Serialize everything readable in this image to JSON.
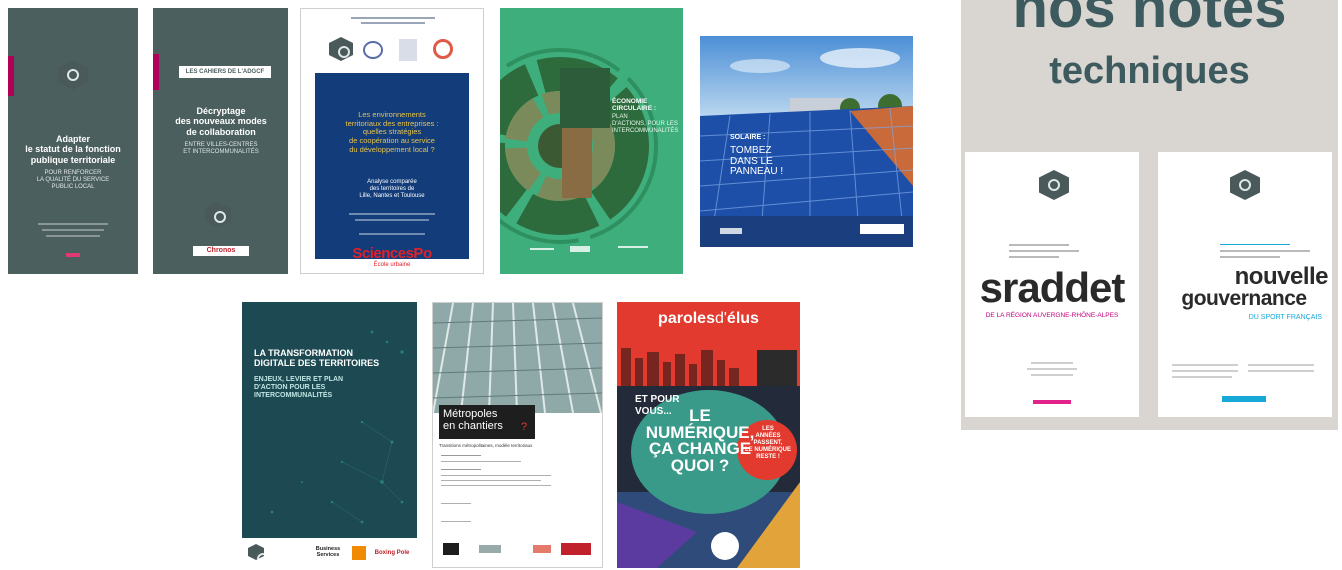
{
  "cover1": {
    "title": "Adapter\nle statut de la fonction\npublique territoriale",
    "subtitle": "POUR RENFORCER\nLA QUALITÉ DU SERVICE\nPUBLIC LOCAL"
  },
  "cover2": {
    "tag": "LES CAHIERS DE L'ADGCF",
    "title": "Décryptage\ndes nouveaux modes\nde collaboration",
    "subtitle": "ENTRE VILLES-CENTRES\nET INTERCOMMUNALITÉS",
    "partner": "Chronos"
  },
  "cover3": {
    "title": "Les environnements\nterritoriaux des entreprises :\nquelles stratégies\nde coopération au service\ndu développement local ?",
    "subtitle": "Analyse comparée\ndes territoires de\nLille, Nantes et Toulouse",
    "brand": "SciencesPo",
    "brand_sub": "École urbaine"
  },
  "cover4": {
    "title": "ÉCONOMIE\nCIRCULAIRE :",
    "subtitle": "PLAN\nD'ACTIONS, POUR LES\nINTERCOMMUNALITÉS"
  },
  "cover5": {
    "title": "SOLAIRE :",
    "subtitle": "TOMBEZ\nDANS LE\nPANNEAU !"
  },
  "cover6": {
    "title": "LA TRANSFORMATION\nDIGITALE DES TERRITOIRES",
    "subtitle": "ENJEUX, LEVIER ET PLAN\nD'ACTION POUR LES\nINTERCOMMUNALITÉS",
    "partner1": "Business\nServices",
    "partner2": "Boxing Pole"
  },
  "cover7": {
    "title": "Métropoles\nen chantiers",
    "title_suffix": "?",
    "subtitle": "Transitions métropolitaines, modèle territoriaux"
  },
  "cover8": {
    "brand_left": "paroles",
    "brand_amp": "d'",
    "brand_right": "élus",
    "kicker": "ET POUR\nVOUS...",
    "headline": "LE\nNUMÉRIQUE,\nÇA CHANGE\nQUOI ?",
    "circle_text": "LES\nANNÉES\nPASSENT,\nLE NUMÉRIQUE\nRESTE !"
  },
  "panel": {
    "heading_line1": "nos notes",
    "heading_line2": "techniques",
    "card1": {
      "word": "sraddet",
      "sub": "DE LA RÉGION AUVERGNE-RHÔNE-ALPES"
    },
    "card2": {
      "word1": "nouvelle",
      "word2": "gouvernance",
      "sub": "DU SPORT FRANÇAIS"
    }
  },
  "colors": {
    "slate": "#4c5f5f",
    "navy": "#123d7a",
    "green": "#3eaf7c",
    "teal_dark": "#1d4a52",
    "red": "#e23a2e",
    "panel_bg": "#d9d5d0",
    "heading": "#3d5b5f",
    "magenta": "#c0007a",
    "cyan": "#18a8d8"
  }
}
